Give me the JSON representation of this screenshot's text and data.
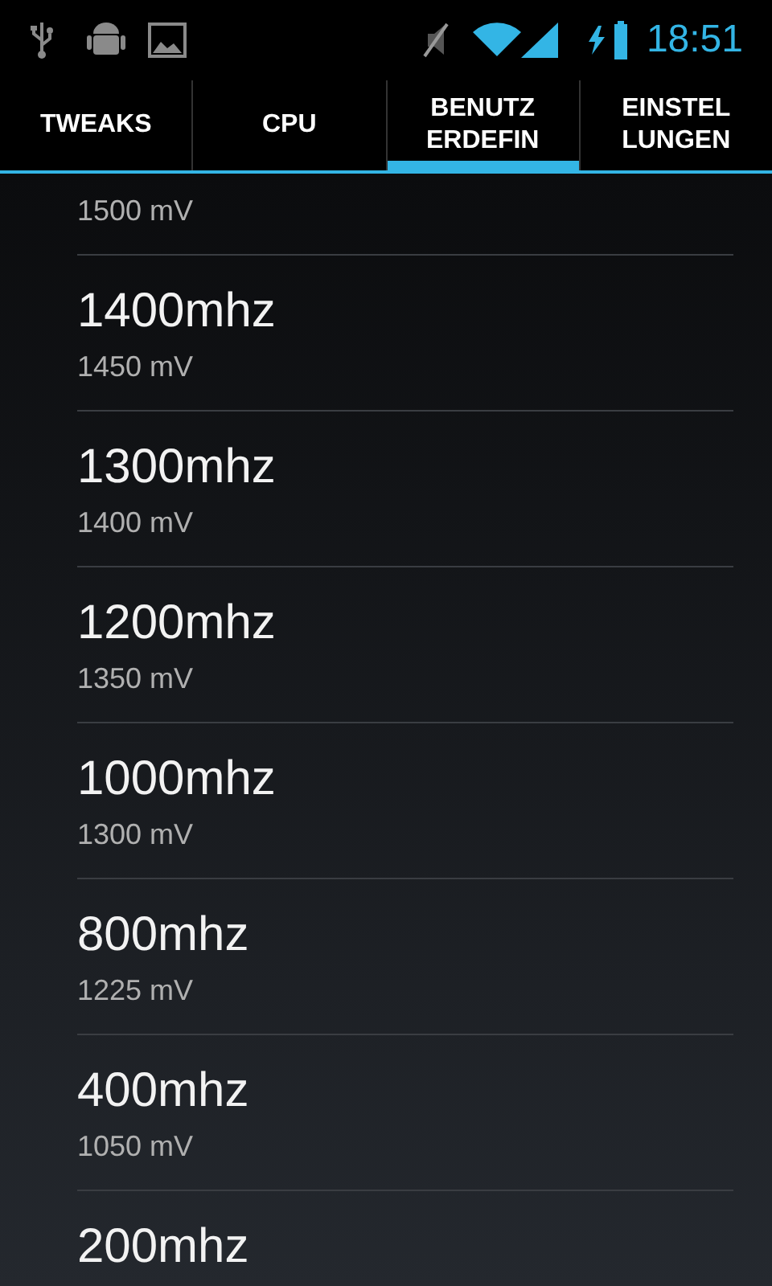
{
  "status_bar": {
    "time": "18:51"
  },
  "tabs": [
    {
      "label": "TWEAKS",
      "selected": false
    },
    {
      "label": "CPU",
      "selected": false
    },
    {
      "label": "BENUTZ\nERDEFIN",
      "selected": true
    },
    {
      "label": "EINSTEL\nLUNGEN",
      "selected": false
    }
  ],
  "list": [
    {
      "value": "1500 mV"
    },
    {
      "title": "1400mhz",
      "value": "1450 mV"
    },
    {
      "title": "1300mhz",
      "value": "1400 mV"
    },
    {
      "title": "1200mhz",
      "value": "1350 mV"
    },
    {
      "title": "1000mhz",
      "value": "1300 mV"
    },
    {
      "title": "800mhz",
      "value": "1225 mV"
    },
    {
      "title": "400mhz",
      "value": "1050 mV"
    },
    {
      "title": "200mhz"
    }
  ]
}
